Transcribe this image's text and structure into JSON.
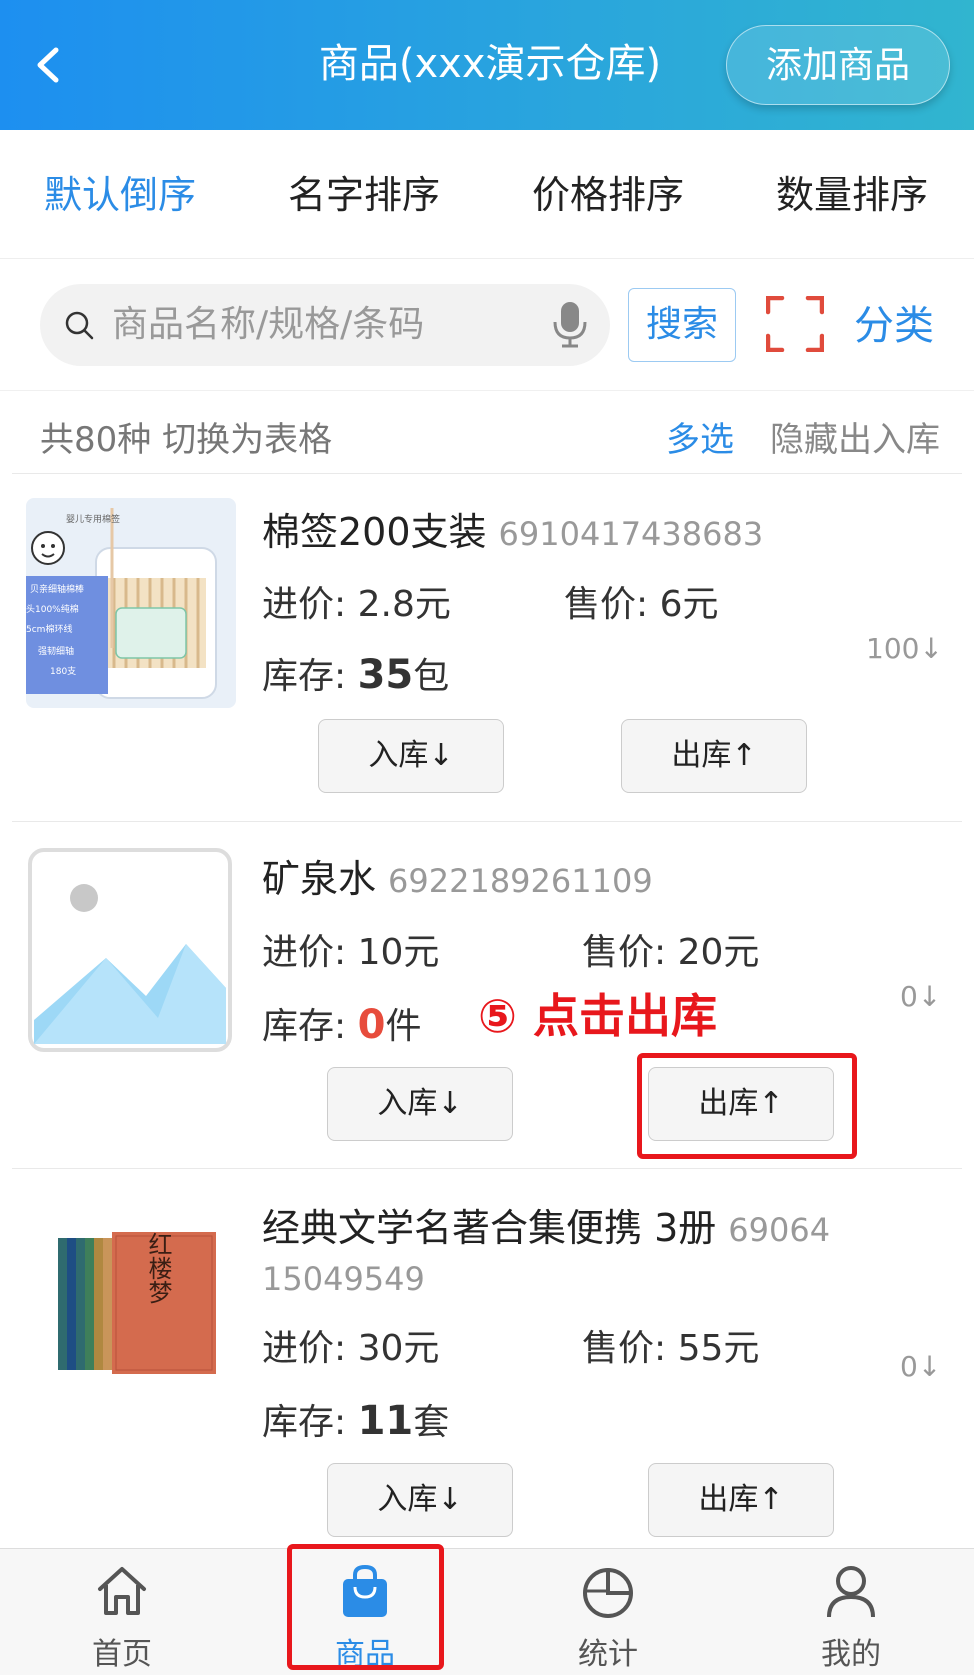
{
  "header": {
    "title": "商品(xxx演示仓库)",
    "add_button": "添加商品",
    "back_icon": "chevron-left-icon"
  },
  "sort_tabs": [
    {
      "label": "默认倒序",
      "active": true
    },
    {
      "label": "名字排序",
      "active": false
    },
    {
      "label": "价格排序",
      "active": false
    },
    {
      "label": "数量排序",
      "active": false
    }
  ],
  "search": {
    "placeholder": "商品名称/规格/条码",
    "button": "搜索",
    "category": "分类"
  },
  "summary": {
    "count_text": "共80种 切换为表格",
    "multi_select": "多选",
    "hide_inout": "隐藏出入库"
  },
  "products": [
    {
      "name": "棉签200支装",
      "code": "6910417438683",
      "cost_label": "进价:",
      "cost": "2.8元",
      "sale_label": "售价:",
      "sale": "6元",
      "stock_label": "库存:",
      "stock_num": "35",
      "stock_unit": "包",
      "qty": "100↓",
      "in_button": "入库↓",
      "out_button": "出库↑"
    },
    {
      "name": "矿泉水",
      "code": "6922189261109",
      "cost_label": "进价:",
      "cost": "10元",
      "sale_label": "售价:",
      "sale": "20元",
      "stock_label": "库存:",
      "stock_num": "0",
      "stock_unit": "件",
      "qty": "0↓",
      "in_button": "入库↓",
      "out_button": "出库↑"
    },
    {
      "name": "经典文学名著合集便携  3册",
      "code": "69064",
      "code_cont": "15049549",
      "cost_label": "进价:",
      "cost": "30元",
      "sale_label": "售价:",
      "sale": "55元",
      "stock_label": "库存:",
      "stock_num": "11",
      "stock_unit": "套",
      "qty": "0↓",
      "in_button": "入库↓",
      "out_button": "出库↑"
    }
  ],
  "annotation": "⑤ 点击出库",
  "thumb_text": {
    "cotton": [
      "婴儿专用棉签",
      "贝亲细轴棉棒",
      "头100%纯棉",
      "5cm棉环线",
      "强韧细轴",
      "180支"
    ],
    "book": "红楼梦"
  },
  "tabbar": [
    {
      "label": "首页",
      "icon": "home-icon",
      "active": false
    },
    {
      "label": "商品",
      "icon": "shopping-bag-icon",
      "active": true
    },
    {
      "label": "统计",
      "icon": "pie-chart-icon",
      "active": false
    },
    {
      "label": "我的",
      "icon": "user-icon",
      "active": false
    }
  ],
  "colors": {
    "accent": "#2b8ce6",
    "annotation_red": "#e8171c",
    "stock_zero": "#e74c3c"
  }
}
